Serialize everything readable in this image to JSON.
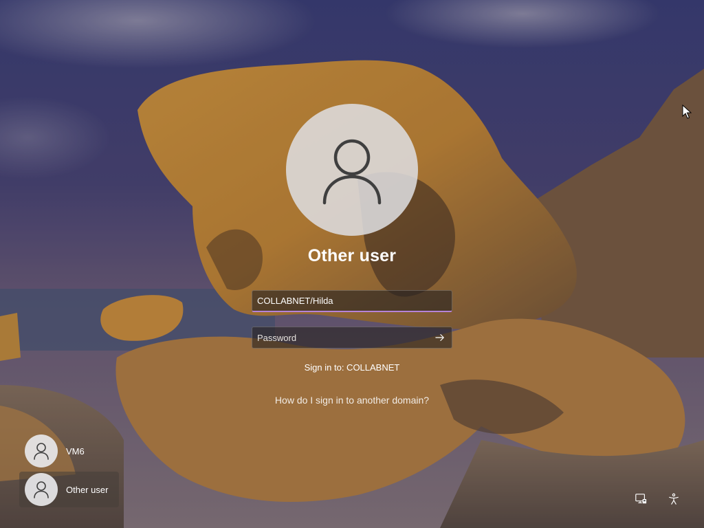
{
  "login": {
    "selected_user_name": "Other user",
    "username_value": "COLLABNET/Hilda",
    "password_placeholder": "Password",
    "sign_in_to": "Sign in to: COLLABNET",
    "other_domain_link": "How do I sign in to another domain?"
  },
  "user_list": [
    {
      "label": "VM6"
    },
    {
      "label": "Other user"
    }
  ],
  "corner_buttons": {
    "network_icon": "network-icon",
    "accessibility_icon": "accessibility-icon"
  },
  "colors": {
    "input_focus_accent": "#b583d9",
    "avatar_background": "#dededf",
    "text": "#ffffff"
  }
}
